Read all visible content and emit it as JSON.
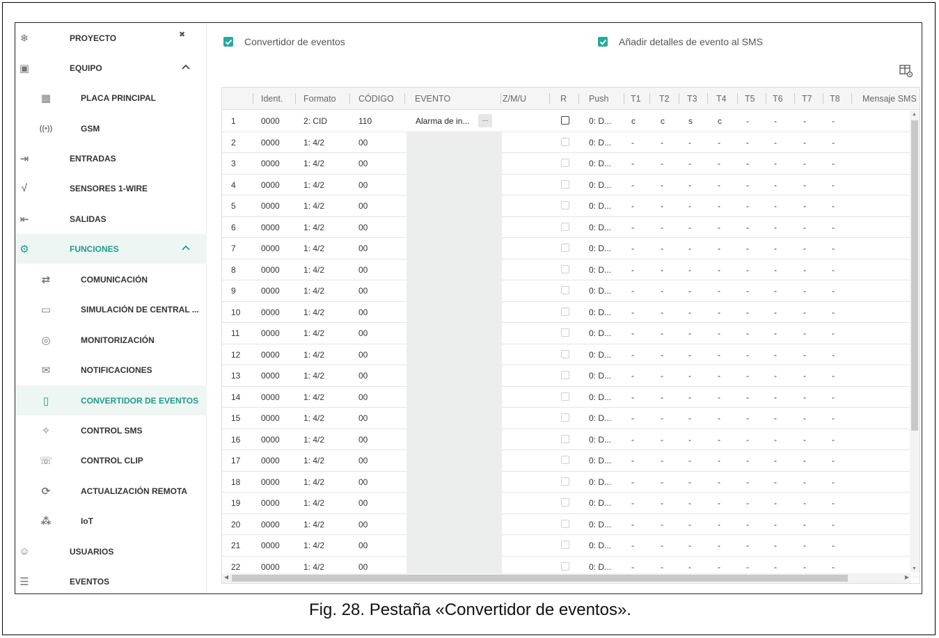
{
  "sidebar": {
    "items": [
      {
        "label": "PROYECTO",
        "icon": "snowflake-icon",
        "level": 0,
        "pinned": true
      },
      {
        "label": "EQUIPO",
        "icon": "chip-icon",
        "level": 0,
        "expanded": true
      },
      {
        "label": "PLACA PRINCIPAL",
        "icon": "board-icon",
        "level": 1
      },
      {
        "label": "GSM",
        "icon": "antenna-icon",
        "level": 1
      },
      {
        "label": "ENTRADAS",
        "icon": "input-icon",
        "level": 0
      },
      {
        "label": "SENSORES 1-WIRE",
        "icon": "sensor-icon",
        "level": 0
      },
      {
        "label": "SALIDAS",
        "icon": "output-icon",
        "level": 0
      },
      {
        "label": "FUNCIONES",
        "icon": "gear-icon",
        "level": 0,
        "expanded": true,
        "active": true
      },
      {
        "label": "COMUNICACIÓN",
        "icon": "communication-icon",
        "level": 1
      },
      {
        "label": "SIMULACIÓN DE CENTRAL ...",
        "icon": "panel-simulation-icon",
        "level": 1
      },
      {
        "label": "MONITORIZACIÓN",
        "icon": "eye-icon",
        "level": 1
      },
      {
        "label": "NOTIFICACIONES",
        "icon": "notification-icon",
        "level": 1
      },
      {
        "label": "CONVERTIDOR DE EVENTOS",
        "icon": "event-converter-icon",
        "level": 1,
        "selected": true
      },
      {
        "label": "CONTROL SMS",
        "icon": "sms-control-icon",
        "level": 1
      },
      {
        "label": "CONTROL CLIP",
        "icon": "clip-control-icon",
        "level": 1
      },
      {
        "label": "ACTUALIZACIÓN REMOTA",
        "icon": "remote-update-icon",
        "level": 1
      },
      {
        "label": "IoT",
        "icon": "iot-icon",
        "level": 1
      },
      {
        "label": "USUARIOS",
        "icon": "users-icon",
        "level": 0
      },
      {
        "label": "EVENTOS",
        "icon": "events-icon",
        "level": 0
      }
    ]
  },
  "toolbar": {
    "converter_label": "Convertidor de eventos",
    "sms_details_label": "Añadir detalles de evento al SMS",
    "converter_checked": true,
    "sms_details_checked": true
  },
  "table": {
    "columns": [
      "",
      "Ident.",
      "Formato",
      "CÓDIGO",
      "EVENTO",
      "Z/M/U",
      "R",
      "Push",
      "T1",
      "T2",
      "T3",
      "T4",
      "T5",
      "T6",
      "T7",
      "T8",
      "Mensaje SMS"
    ],
    "rows": [
      {
        "n": "1",
        "ident": "0000",
        "formato": "2: CID",
        "codigo": "110",
        "evento": "Alarma de in...",
        "r": false,
        "push": "0: D...",
        "t": [
          "c",
          "c",
          "s",
          "c",
          "-",
          "-",
          "-",
          "-"
        ]
      },
      {
        "n": "2",
        "ident": "0000",
        "formato": "1: 4/2",
        "codigo": "00",
        "evento": "",
        "r": false,
        "push": "0: D...",
        "t": [
          "-",
          "-",
          "-",
          "-",
          "-",
          "-",
          "-",
          "-"
        ]
      },
      {
        "n": "3",
        "ident": "0000",
        "formato": "1: 4/2",
        "codigo": "00",
        "evento": "",
        "r": false,
        "push": "0: D...",
        "t": [
          "-",
          "-",
          "-",
          "-",
          "-",
          "-",
          "-",
          "-"
        ]
      },
      {
        "n": "4",
        "ident": "0000",
        "formato": "1: 4/2",
        "codigo": "00",
        "evento": "",
        "r": false,
        "push": "0: D...",
        "t": [
          "-",
          "-",
          "-",
          "-",
          "-",
          "-",
          "-",
          "-"
        ]
      },
      {
        "n": "5",
        "ident": "0000",
        "formato": "1: 4/2",
        "codigo": "00",
        "evento": "",
        "r": false,
        "push": "0: D...",
        "t": [
          "-",
          "-",
          "-",
          "-",
          "-",
          "-",
          "-",
          "-"
        ]
      },
      {
        "n": "6",
        "ident": "0000",
        "formato": "1: 4/2",
        "codigo": "00",
        "evento": "",
        "r": false,
        "push": "0: D...",
        "t": [
          "-",
          "-",
          "-",
          "-",
          "-",
          "-",
          "-",
          "-"
        ]
      },
      {
        "n": "7",
        "ident": "0000",
        "formato": "1: 4/2",
        "codigo": "00",
        "evento": "",
        "r": false,
        "push": "0: D...",
        "t": [
          "-",
          "-",
          "-",
          "-",
          "-",
          "-",
          "-",
          "-"
        ]
      },
      {
        "n": "8",
        "ident": "0000",
        "formato": "1: 4/2",
        "codigo": "00",
        "evento": "",
        "r": false,
        "push": "0: D...",
        "t": [
          "-",
          "-",
          "-",
          "-",
          "-",
          "-",
          "-",
          "-"
        ]
      },
      {
        "n": "9",
        "ident": "0000",
        "formato": "1: 4/2",
        "codigo": "00",
        "evento": "",
        "r": false,
        "push": "0: D...",
        "t": [
          "-",
          "-",
          "-",
          "-",
          "-",
          "-",
          "-",
          "-"
        ]
      },
      {
        "n": "10",
        "ident": "0000",
        "formato": "1: 4/2",
        "codigo": "00",
        "evento": "",
        "r": false,
        "push": "0: D...",
        "t": [
          "-",
          "-",
          "-",
          "-",
          "-",
          "-",
          "-",
          "-"
        ]
      },
      {
        "n": "11",
        "ident": "0000",
        "formato": "1: 4/2",
        "codigo": "00",
        "evento": "",
        "r": false,
        "push": "0: D...",
        "t": [
          "-",
          "-",
          "-",
          "-",
          "-",
          "-",
          "-",
          "-"
        ]
      },
      {
        "n": "12",
        "ident": "0000",
        "formato": "1: 4/2",
        "codigo": "00",
        "evento": "",
        "r": false,
        "push": "0: D...",
        "t": [
          "-",
          "-",
          "-",
          "-",
          "-",
          "-",
          "-",
          "-"
        ]
      },
      {
        "n": "13",
        "ident": "0000",
        "formato": "1: 4/2",
        "codigo": "00",
        "evento": "",
        "r": false,
        "push": "0: D...",
        "t": [
          "-",
          "-",
          "-",
          "-",
          "-",
          "-",
          "-",
          "-"
        ]
      },
      {
        "n": "14",
        "ident": "0000",
        "formato": "1: 4/2",
        "codigo": "00",
        "evento": "",
        "r": false,
        "push": "0: D...",
        "t": [
          "-",
          "-",
          "-",
          "-",
          "-",
          "-",
          "-",
          "-"
        ]
      },
      {
        "n": "15",
        "ident": "0000",
        "formato": "1: 4/2",
        "codigo": "00",
        "evento": "",
        "r": false,
        "push": "0: D...",
        "t": [
          "-",
          "-",
          "-",
          "-",
          "-",
          "-",
          "-",
          "-"
        ]
      },
      {
        "n": "16",
        "ident": "0000",
        "formato": "1: 4/2",
        "codigo": "00",
        "evento": "",
        "r": false,
        "push": "0: D...",
        "t": [
          "-",
          "-",
          "-",
          "-",
          "-",
          "-",
          "-",
          "-"
        ]
      },
      {
        "n": "17",
        "ident": "0000",
        "formato": "1: 4/2",
        "codigo": "00",
        "evento": "",
        "r": false,
        "push": "0: D...",
        "t": [
          "-",
          "-",
          "-",
          "-",
          "-",
          "-",
          "-",
          "-"
        ]
      },
      {
        "n": "18",
        "ident": "0000",
        "formato": "1: 4/2",
        "codigo": "00",
        "evento": "",
        "r": false,
        "push": "0: D...",
        "t": [
          "-",
          "-",
          "-",
          "-",
          "-",
          "-",
          "-",
          "-"
        ]
      },
      {
        "n": "19",
        "ident": "0000",
        "formato": "1: 4/2",
        "codigo": "00",
        "evento": "",
        "r": false,
        "push": "0: D...",
        "t": [
          "-",
          "-",
          "-",
          "-",
          "-",
          "-",
          "-",
          "-"
        ]
      },
      {
        "n": "20",
        "ident": "0000",
        "formato": "1: 4/2",
        "codigo": "00",
        "evento": "",
        "r": false,
        "push": "0: D...",
        "t": [
          "-",
          "-",
          "-",
          "-",
          "-",
          "-",
          "-",
          "-"
        ]
      },
      {
        "n": "21",
        "ident": "0000",
        "formato": "1: 4/2",
        "codigo": "00",
        "evento": "",
        "r": false,
        "push": "0: D...",
        "t": [
          "-",
          "-",
          "-",
          "-",
          "-",
          "-",
          "-",
          "-"
        ]
      },
      {
        "n": "22",
        "ident": "0000",
        "formato": "1: 4/2",
        "codigo": "00",
        "evento": "",
        "r": false,
        "push": "0: D...",
        "t": [
          "-",
          "-",
          "-",
          "-",
          "-",
          "-",
          "-",
          "-"
        ]
      }
    ],
    "event_button_label": "..."
  },
  "caption": "Fig. 28. Pestaña «Convertidor de eventos».",
  "colors": {
    "accent": "#2aa79b",
    "active_bg": "#eef6f4",
    "event_cell_bg": "#eceeed"
  }
}
